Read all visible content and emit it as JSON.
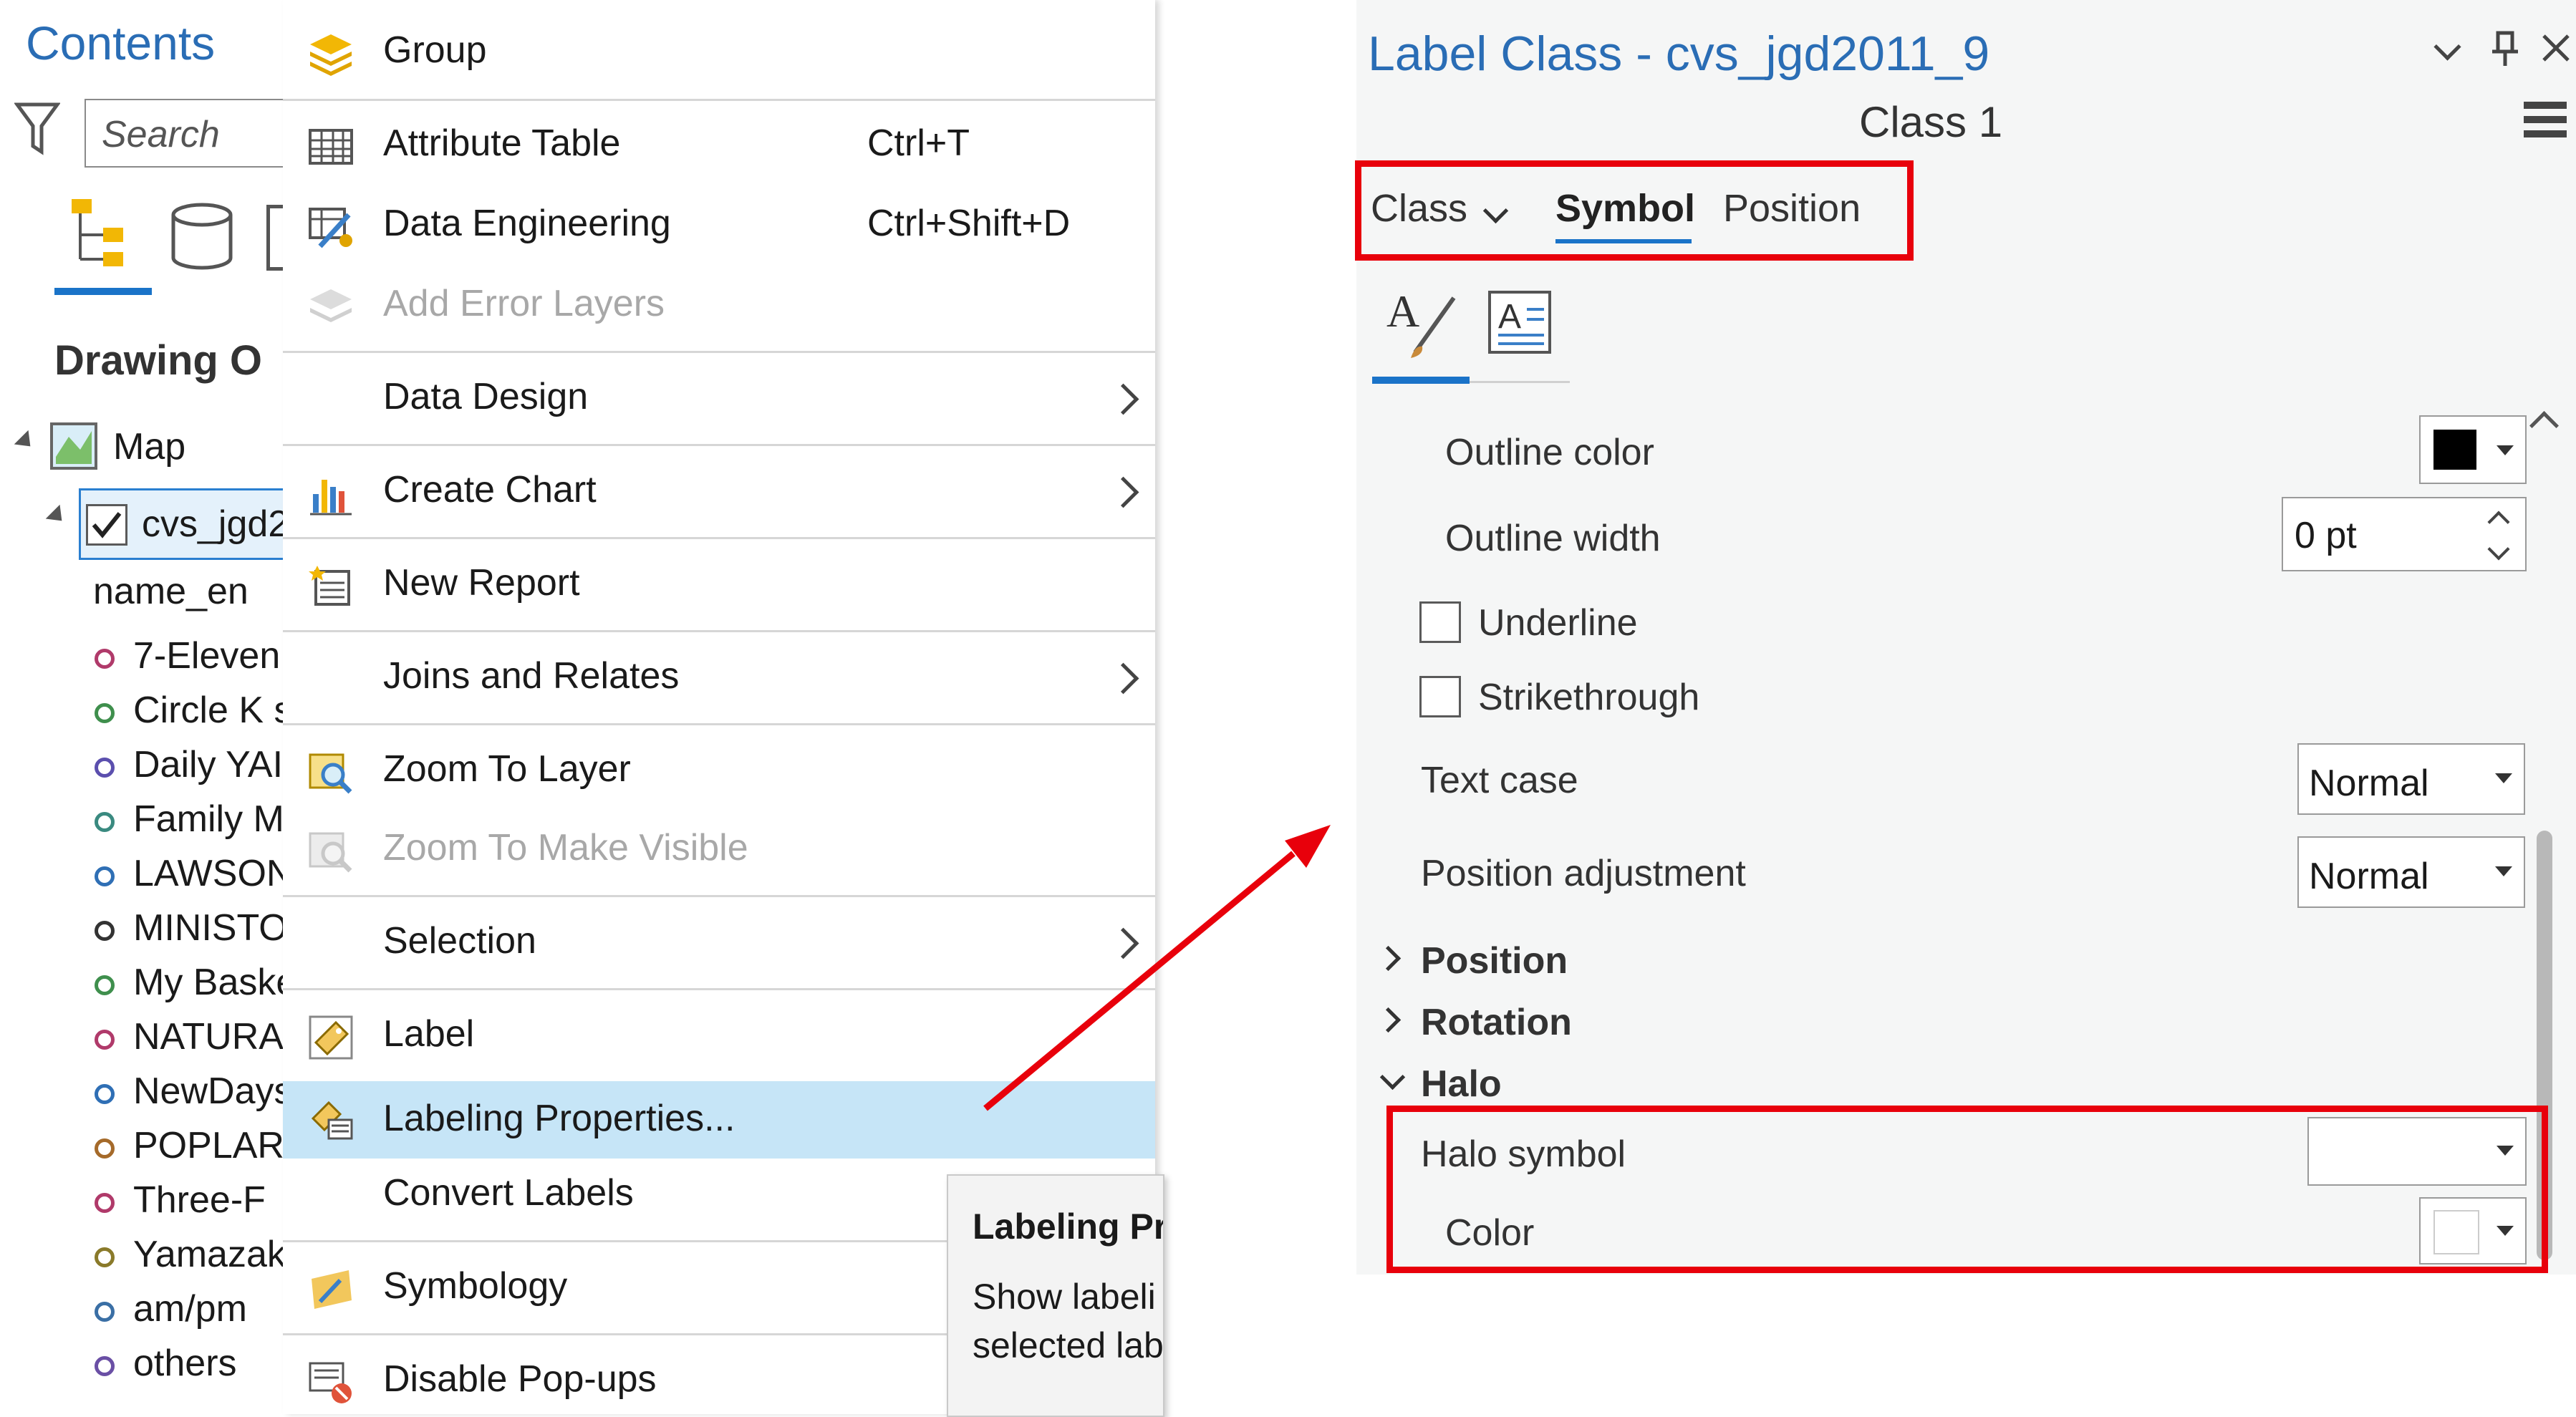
{
  "contents": {
    "title": "Contents",
    "search_placeholder": "Search",
    "drawing_order": "Drawing O",
    "map": "Map",
    "layer": "cvs_jgd2",
    "field": "name_en",
    "items": [
      {
        "label": "7-Eleven",
        "color": "#b03a6a"
      },
      {
        "label": "Circle K s",
        "color": "#3f8f4d"
      },
      {
        "label": "Daily YAI",
        "color": "#5b4fae"
      },
      {
        "label": "Family M",
        "color": "#3a8a80"
      },
      {
        "label": "LAWSON",
        "color": "#2f6fb5"
      },
      {
        "label": "MINISTO",
        "color": "#333333"
      },
      {
        "label": "My Baske",
        "color": "#3f8f4d"
      },
      {
        "label": "NATURAI",
        "color": "#b03a6a"
      },
      {
        "label": "NewDays",
        "color": "#2f6fb5"
      },
      {
        "label": "POPLAR",
        "color": "#a56a2a"
      },
      {
        "label": "Three-F",
        "color": "#b03a6a"
      },
      {
        "label": "Yamazak",
        "color": "#8a7a2a"
      },
      {
        "label": "am/pm",
        "color": "#3a6fa5"
      },
      {
        "label": "others",
        "color": "#6a4fa5"
      }
    ]
  },
  "menu": {
    "group": "Group",
    "attribute_table": "Attribute Table",
    "attribute_table_shortcut": "Ctrl+T",
    "data_engineering": "Data Engineering",
    "data_engineering_shortcut": "Ctrl+Shift+D",
    "add_error_layers": "Add Error Layers",
    "data_design": "Data Design",
    "create_chart": "Create Chart",
    "new_report": "New Report",
    "joins_relates": "Joins and Relates",
    "zoom_to_layer": "Zoom To Layer",
    "zoom_to_visible": "Zoom To Make Visible",
    "selection": "Selection",
    "label": "Label",
    "labeling_properties": "Labeling Properties...",
    "convert_labels": "Convert Labels",
    "symbology": "Symbology",
    "disable_popups": "Disable Pop-ups"
  },
  "tooltip": {
    "title": "Labeling Pr",
    "line1": "Show labeli",
    "line2": "selected lab"
  },
  "label_class": {
    "title": "Label Class - cvs_jgd2011_9",
    "class_name": "Class 1",
    "tabs": {
      "class": "Class",
      "symbol": "Symbol",
      "position": "Position"
    },
    "outline_color": "Outline color",
    "outline_width": "Outline width",
    "outline_width_value": "0 pt",
    "underline": "Underline",
    "strikethrough": "Strikethrough",
    "text_case": "Text case",
    "text_case_value": "Normal",
    "position_adjustment": "Position adjustment",
    "position_adjustment_value": "Normal",
    "section_position": "Position",
    "section_rotation": "Rotation",
    "section_halo": "Halo",
    "halo_symbol": "Halo symbol",
    "color": "Color"
  },
  "colors": {
    "accent": "#2a6db5",
    "highlight": "#c6e5f7",
    "annotation": "#e8000b"
  }
}
